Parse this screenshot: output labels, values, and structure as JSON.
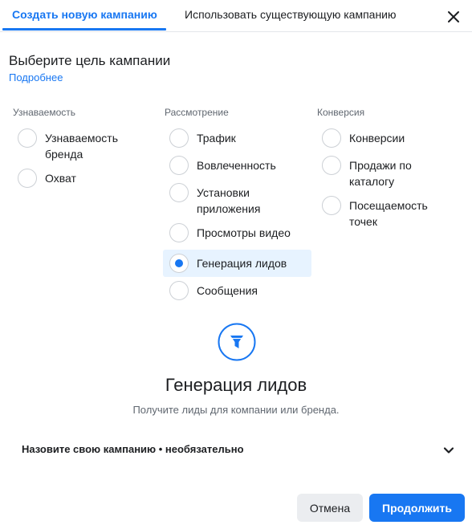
{
  "tabs": {
    "create_new": "Создать новую кампанию",
    "use_existing": "Использовать существующую кампанию"
  },
  "heading": "Выберите цель кампании",
  "learn_more": "Подробнее",
  "columns": {
    "awareness": {
      "title": "Узнаваемость",
      "options": [
        "Узнаваемость бренда",
        "Охват"
      ]
    },
    "consideration": {
      "title": "Рассмотрение",
      "options": [
        "Трафик",
        "Вовлеченность",
        "Установки приложения",
        "Просмотры видео",
        "Генерация лидов",
        "Сообщения"
      ]
    },
    "conversion": {
      "title": "Конверсия",
      "options": [
        "Конверсии",
        "Продажи по каталогу",
        "Посещаемость точек"
      ]
    }
  },
  "selected_objective": "Генерация лидов",
  "objective_panel": {
    "title": "Генерация лидов",
    "description": "Получите лиды для компании или бренда."
  },
  "campaign_name_label": "Назовите свою кампанию • необязательно",
  "buttons": {
    "cancel": "Отмена",
    "continue": "Продолжить"
  },
  "colors": {
    "accent": "#1877f2",
    "selected_bg": "#e7f3ff",
    "muted_text": "#606770"
  },
  "icons": {
    "close": "close-icon",
    "objective": "funnel-icon",
    "expand": "chevron-down-icon"
  }
}
